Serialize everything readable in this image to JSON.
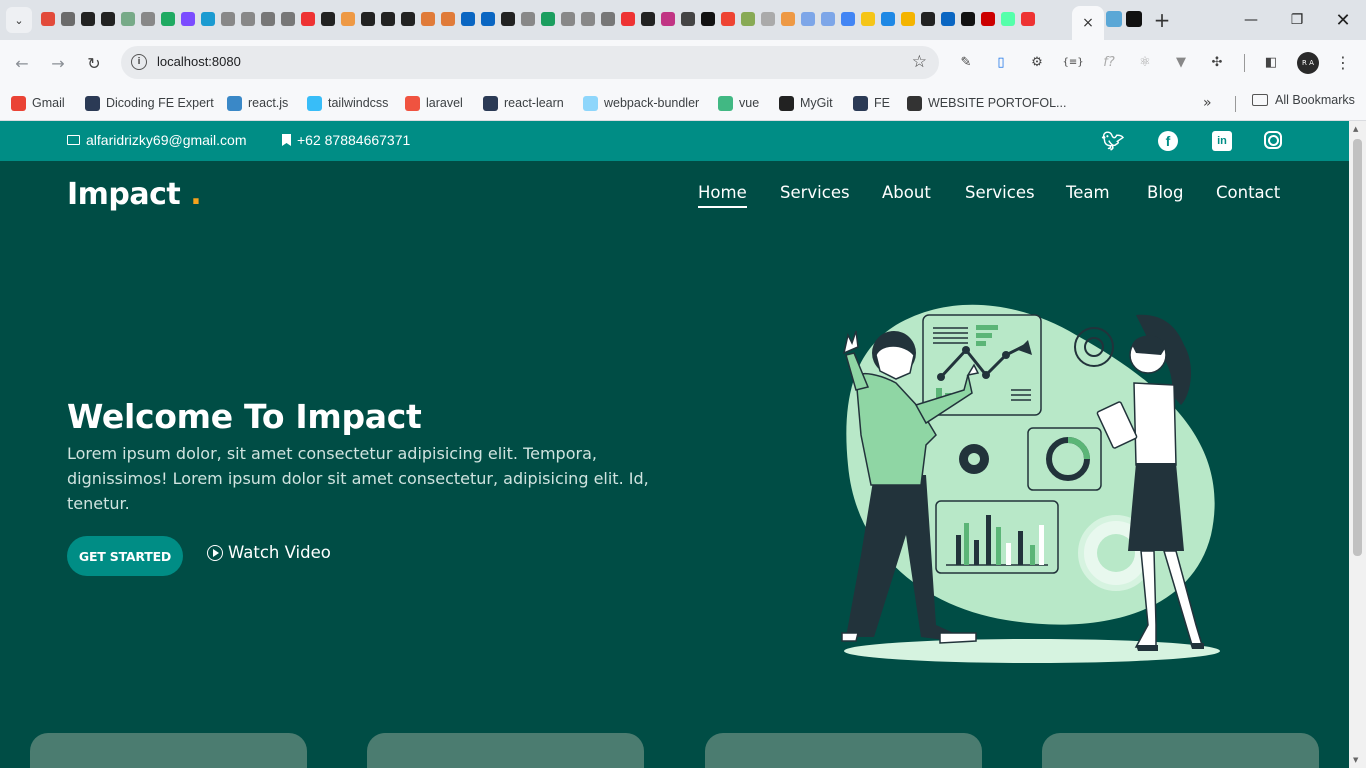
{
  "browser": {
    "tab_close": "×",
    "new_tab": "+",
    "url": "localhost:8080",
    "pinned_tab_colors": [
      "#e24b3b",
      "#6b6b6b",
      "#222",
      "#222",
      "#7a8",
      "#888",
      "#1faa62",
      "#7b4cff",
      "#1b9bd1",
      "#888",
      "#888",
      "#777",
      "#777",
      "#e33",
      "#222",
      "#e94",
      "#222",
      "#222",
      "#222",
      "#e07b39",
      "#e07b39",
      "#0a66c2",
      "#0a66c2",
      "#222",
      "#888",
      "#1b9e5f",
      "#888",
      "#888",
      "#777",
      "#e33",
      "#222",
      "#c13584",
      "#444",
      "#111",
      "#e43",
      "#8a5",
      "#aaa",
      "#e94",
      "#7da6e8",
      "#7da6e8",
      "#4285f4",
      "#f5c518",
      "#1e88e5",
      "#f4b400",
      "#222",
      "#0a66c2",
      "#111",
      "#c00",
      "#5fa",
      "#e33"
    ],
    "profile_initials": "R A",
    "bookmarks": [
      {
        "label": "Gmail",
        "color": "#ea4335"
      },
      {
        "label": "Dicoding FE Expert",
        "color": "#2b3a55"
      },
      {
        "label": "react.js",
        "color": "#3a88c7"
      },
      {
        "label": "tailwindcss",
        "color": "#38bdf8"
      },
      {
        "label": "laravel",
        "color": "#f05340"
      },
      {
        "label": "react-learn",
        "color": "#2b3a55"
      },
      {
        "label": "webpack-bundler",
        "color": "#8ed6fb"
      },
      {
        "label": "vue",
        "color": "#41b883"
      },
      {
        "label": "MyGit",
        "color": "#222222"
      },
      {
        "label": "FE",
        "color": "#2b3a55"
      },
      {
        "label": "WEBSITE PORTOFOL...",
        "color": "#333333"
      }
    ],
    "all_bookmarks": "All Bookmarks"
  },
  "page": {
    "email": "alfaridrizky69@gmail.com",
    "phone": "+62 87884667371",
    "logo_text": "Impact",
    "logo_dot": ".",
    "nav": [
      "Home",
      "Services",
      "About",
      "Services",
      "Team",
      "Blog",
      "Contact"
    ],
    "hero_title": "Welcome To Impact",
    "hero_text": "Lorem ipsum dolor, sit amet consectetur adipisicing elit. Tempora, dignissimos! Lorem ipsum dolor sit amet consectetur, adipisicing elit. Id, tenetur.",
    "cta_button": "GET STARTED",
    "watch_video": "Watch Video",
    "colors": {
      "topbar": "#008d85",
      "background": "#004d45",
      "accent": "#f6a21d",
      "card": "#4b7c70"
    },
    "social_icons": [
      "twitter-icon",
      "facebook-icon",
      "linkedin-icon",
      "instagram-icon"
    ]
  }
}
